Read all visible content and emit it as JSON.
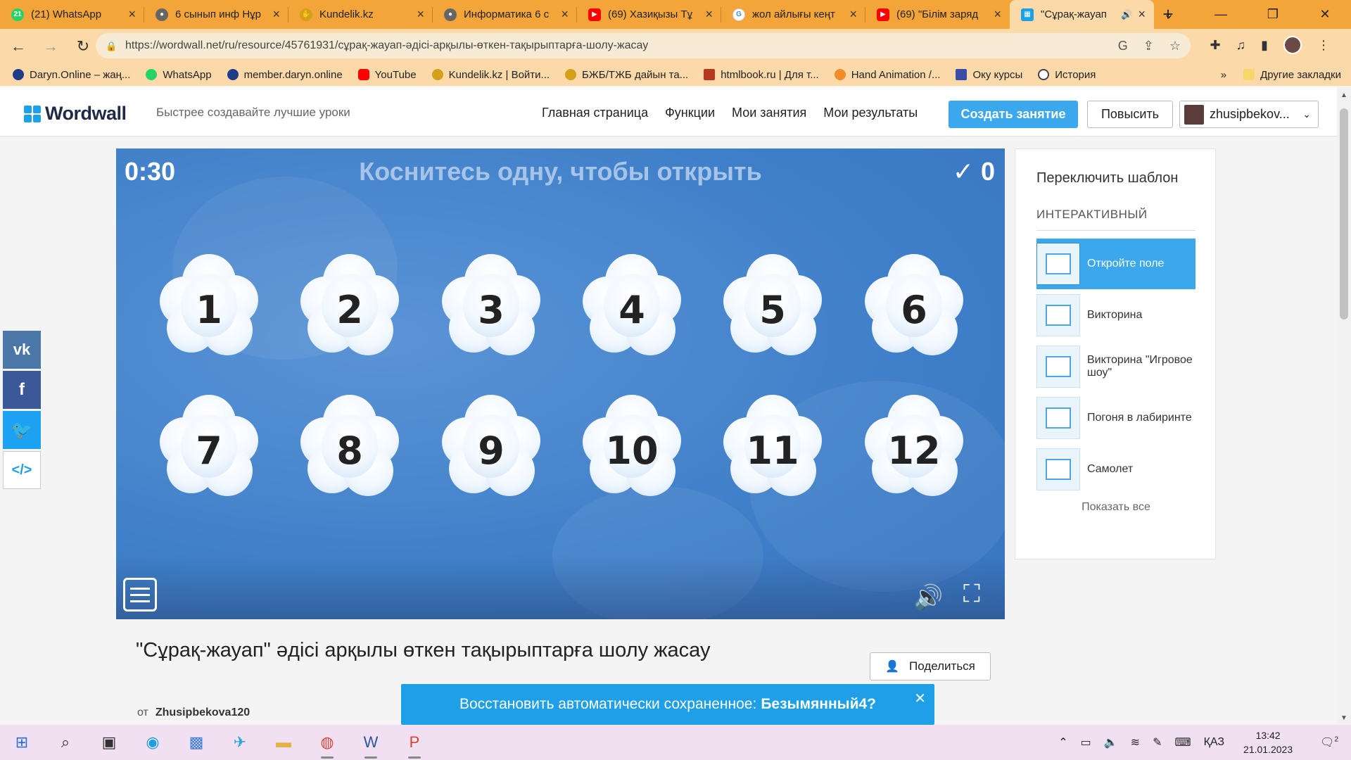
{
  "browser": {
    "tabs": [
      {
        "title": "(21) WhatsApp",
        "icon": "whatsapp-icon",
        "color": "#25d366",
        "active": false
      },
      {
        "title": "6 сынып инф Нұр",
        "icon": "globe-icon",
        "color": "#666666",
        "active": false
      },
      {
        "title": "Kundelik.kz",
        "icon": "kundelik-icon",
        "color": "#d4a017",
        "active": false
      },
      {
        "title": "Информатика 6 с",
        "icon": "globe-icon",
        "color": "#666666",
        "active": false
      },
      {
        "title": "(69) Хазиқызы Тұ",
        "icon": "youtube-icon",
        "color": "#ff0000",
        "active": false
      },
      {
        "title": "жол айлығы кеңт",
        "icon": "google-icon",
        "color": "#4285f4",
        "active": false
      },
      {
        "title": "(69) \"Білім заряд",
        "icon": "youtube-icon",
        "color": "#ff0000",
        "active": false
      },
      {
        "title": "\"Сұрақ-жауап",
        "icon": "wordwall-icon",
        "color": "#1ea0e6",
        "active": true
      }
    ],
    "url": "https://wordwall.net/ru/resource/45761931/сұрақ-жауап-әдісі-арқылы-өткен-тақырыптарға-шолу-жасау",
    "bookmarks": [
      {
        "label": "Daryn.Online – жаң...",
        "color": "#1f3c88"
      },
      {
        "label": "WhatsApp",
        "color": "#25d366"
      },
      {
        "label": "member.daryn.online",
        "color": "#1f3c88"
      },
      {
        "label": "YouTube",
        "color": "#ff0000"
      },
      {
        "label": "Kundelik.kz | Войти...",
        "color": "#d4a017"
      },
      {
        "label": "БЖБ/ТЖБ дайын та...",
        "color": "#d4a017"
      },
      {
        "label": "htmlbook.ru | Для т...",
        "color": "#b5371c"
      },
      {
        "label": "Hand Animation /...",
        "color": "#f28c28"
      },
      {
        "label": "Оку курсы",
        "color": "#3b4ba8"
      },
      {
        "label": "История",
        "color": "#444444"
      }
    ],
    "bookmarks_more": "»",
    "other_bookmarks": "Другие закладки"
  },
  "site": {
    "logo": "Wordwall",
    "tagline": "Быстрее создавайте лучшие уроки",
    "nav": [
      "Главная страница",
      "Функции",
      "Мои занятия",
      "Мои результаты"
    ],
    "create_label": "Создать занятие",
    "upgrade_label": "Повысить",
    "username": "zhusipbekov..."
  },
  "game": {
    "timer": "0:30",
    "instruction": "Коснитесь одну, чтобы открыть",
    "score": "✓ 0",
    "tiles": [
      "1",
      "2",
      "3",
      "4",
      "5",
      "6",
      "7",
      "8",
      "9",
      "10",
      "11",
      "12"
    ]
  },
  "templates": {
    "title": "Переключить шаблон",
    "section": "ИНТЕРАКТИВНЫЙ",
    "items": [
      {
        "label": "Откройте поле",
        "active": true
      },
      {
        "label": "Викторина",
        "active": false
      },
      {
        "label": "Викторина \"Игровое шоу\"",
        "active": false
      },
      {
        "label": "Погоня в лабиринте",
        "active": false
      },
      {
        "label": "Самолет",
        "active": false
      }
    ],
    "show_all": "Показать все"
  },
  "activity": {
    "title": "\"Сұрақ-жауап\" әдісі арқылы өткен тақырыптарға шолу жасау",
    "author_prefix": "от",
    "author": "Zhusipbekova120",
    "share_label": "Поделиться"
  },
  "restore": {
    "text": "Восстановить автоматически сохраненное:",
    "name": "Безымянный4?"
  },
  "taskbar": {
    "lang": "ҚАЗ",
    "time": "13:42",
    "date": "21.01.2023",
    "notifications": "2"
  },
  "colors": {
    "tab_strip": "#f3a53a",
    "toolbar": "#fbd9a8",
    "accent": "#3ba8ee",
    "game_bg": "#3f7fc9",
    "restore_bar": "#1e9fe8",
    "taskbar": "#f0e0f2"
  }
}
